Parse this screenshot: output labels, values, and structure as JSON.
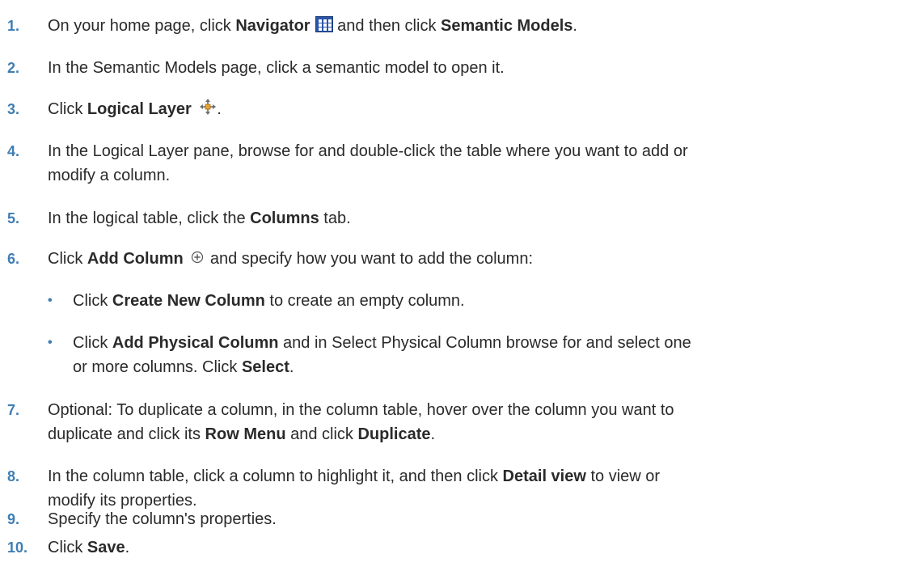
{
  "steps": [
    {
      "num": "1.",
      "parts": [
        "On your home page, click ",
        "Navigator",
        " and then click ",
        "Semantic Models",
        "."
      ],
      "icons": [
        "grid-icon"
      ]
    },
    {
      "num": "2.",
      "text": "In the Semantic Models page, click a semantic model to open it."
    },
    {
      "num": "3.",
      "parts": [
        "Click ",
        "Logical Layer",
        "."
      ],
      "icons": [
        "move-arrows-icon"
      ]
    },
    {
      "num": "4.",
      "line1": "In the Logical Layer pane, browse for and double-click the table where you want to add or",
      "line2": "modify a column."
    },
    {
      "num": "5.",
      "parts": [
        "In the logical table, click the ",
        "Columns",
        " tab."
      ]
    },
    {
      "num": "6.",
      "parts": [
        "Click ",
        "Add Column",
        " and specify how you want to add the column:"
      ],
      "icons": [
        "add-circle-icon"
      ]
    },
    {
      "num": "7.",
      "parts": [
        "Optional: To duplicate a column, in the column table, hover over the column you want to",
        "duplicate and click its ",
        "Row Menu",
        " and click ",
        "Duplicate",
        "."
      ]
    },
    {
      "num": "8.",
      "parts": [
        "In the column table, click a column to highlight it, and then click ",
        "Detail view",
        " to view or",
        "modify its properties."
      ]
    },
    {
      "num": "9.",
      "text": "Specify the column's properties."
    },
    {
      "num": "10.",
      "parts": [
        "Click ",
        "Save",
        "."
      ]
    }
  ],
  "bullets": [
    {
      "mark": "•",
      "parts": [
        "Click ",
        "Create New Column",
        " to create an empty column."
      ]
    },
    {
      "mark": "•",
      "parts": [
        "Click ",
        "Add Physical Column",
        " and in Select Physical Column browse for and select one",
        "or more columns. Click ",
        "Select",
        "."
      ]
    }
  ],
  "colors": {
    "number": "#3f7eb3",
    "text": "#2a2a2a",
    "nav_icon": "#2a55a8"
  }
}
